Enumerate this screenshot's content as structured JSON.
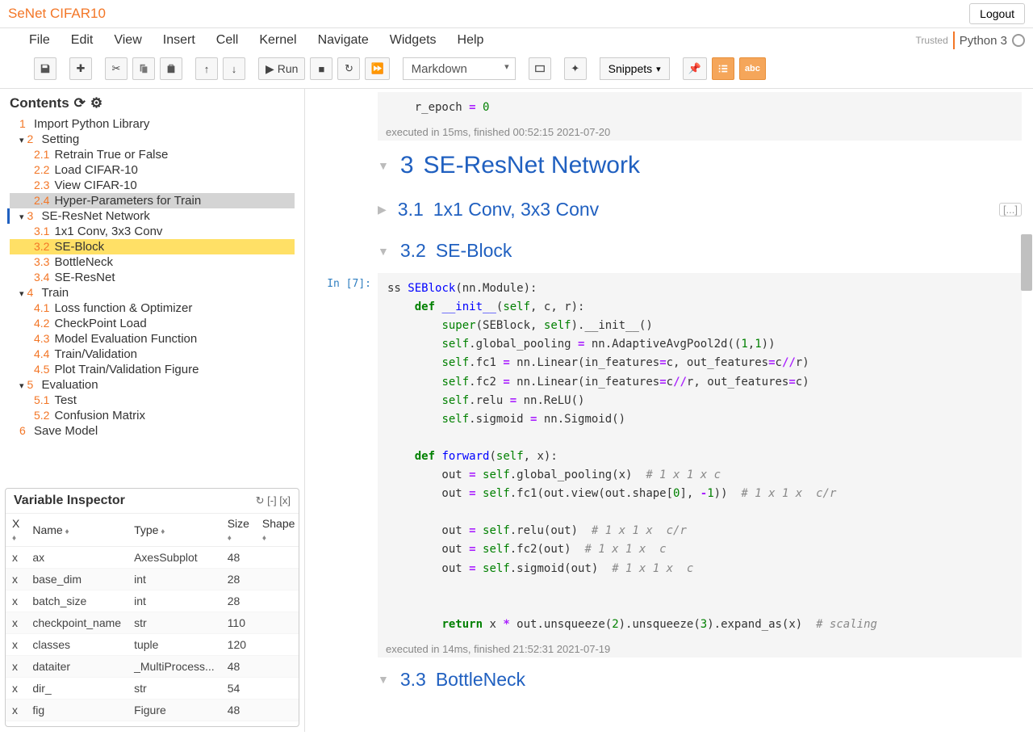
{
  "header": {
    "title": "SeNet CIFAR10",
    "logout": "Logout"
  },
  "menu": {
    "items": [
      "File",
      "Edit",
      "View",
      "Insert",
      "Cell",
      "Kernel",
      "Navigate",
      "Widgets",
      "Help"
    ],
    "trusted": "Trusted",
    "kernel": "Python 3"
  },
  "toolbar": {
    "run": "Run",
    "cell_type": "Markdown",
    "snippets": "Snippets"
  },
  "toc": {
    "title": "Contents",
    "items": [
      {
        "num": "1",
        "label": "Import Python Library",
        "level": 1
      },
      {
        "num": "2",
        "label": "Setting",
        "level": 1,
        "caret": true
      },
      {
        "num": "2.1",
        "label": "Retrain True or False",
        "level": 2
      },
      {
        "num": "2.2",
        "label": "Load CIFAR-10",
        "level": 2
      },
      {
        "num": "2.3",
        "label": "View CIFAR-10",
        "level": 2
      },
      {
        "num": "2.4",
        "label": "Hyper-Parameters for Train",
        "level": 2,
        "selected": true
      },
      {
        "num": "3",
        "label": "SE-ResNet Network",
        "level": 1,
        "caret": true,
        "current": true
      },
      {
        "num": "3.1",
        "label": "1x1 Conv, 3x3 Conv",
        "level": 2
      },
      {
        "num": "3.2",
        "label": "SE-Block",
        "level": 2,
        "highlighted": true
      },
      {
        "num": "3.3",
        "label": "BottleNeck",
        "level": 2
      },
      {
        "num": "3.4",
        "label": "SE-ResNet",
        "level": 2
      },
      {
        "num": "4",
        "label": "Train",
        "level": 1,
        "caret": true
      },
      {
        "num": "4.1",
        "label": "Loss function & Optimizer",
        "level": 2
      },
      {
        "num": "4.2",
        "label": "CheckPoint Load",
        "level": 2
      },
      {
        "num": "4.3",
        "label": "Model Evaluation Function",
        "level": 2
      },
      {
        "num": "4.4",
        "label": "Train/Validation",
        "level": 2
      },
      {
        "num": "4.5",
        "label": "Plot Train/Validation Figure",
        "level": 2
      },
      {
        "num": "5",
        "label": "Evaluation",
        "level": 1,
        "caret": true
      },
      {
        "num": "5.1",
        "label": "Test",
        "level": 2
      },
      {
        "num": "5.2",
        "label": "Confusion Matrix",
        "level": 2
      },
      {
        "num": "6",
        "label": "Save Model",
        "level": 1
      }
    ]
  },
  "varinsp": {
    "title": "Variable Inspector",
    "actions": "↻ [-] [x]",
    "cols": [
      "X",
      "Name",
      "Type",
      "Size",
      "Shape"
    ],
    "rows": [
      {
        "x": "x",
        "name": "ax",
        "type": "AxesSubplot",
        "size": "48"
      },
      {
        "x": "x",
        "name": "base_dim",
        "type": "int",
        "size": "28"
      },
      {
        "x": "x",
        "name": "batch_size",
        "type": "int",
        "size": "28"
      },
      {
        "x": "x",
        "name": "checkpoint_name",
        "type": "str",
        "size": "110"
      },
      {
        "x": "x",
        "name": "classes",
        "type": "tuple",
        "size": "120"
      },
      {
        "x": "x",
        "name": "dataiter",
        "type": "_MultiProcess...",
        "size": "48"
      },
      {
        "x": "x",
        "name": "dir_",
        "type": "str",
        "size": "54"
      },
      {
        "x": "x",
        "name": "fig",
        "type": "Figure",
        "size": "48"
      }
    ]
  },
  "notebook": {
    "code_top": "    r_epoch = 0",
    "exec_top": "executed in 15ms, finished 00:52:15 2021-07-20",
    "h_3_num": "3",
    "h_3": "SE-ResNet Network",
    "h_31_num": "3.1",
    "h_31": "1x1 Conv, 3x3 Conv",
    "h_32_num": "3.2",
    "h_32": "SE-Block",
    "prompt_7": "In [7]:",
    "exec_32": "executed in 14ms, finished 21:52:31 2021-07-19",
    "h_33_num": "3.3",
    "h_33": "BottleNeck",
    "collapsed": "[...]"
  }
}
